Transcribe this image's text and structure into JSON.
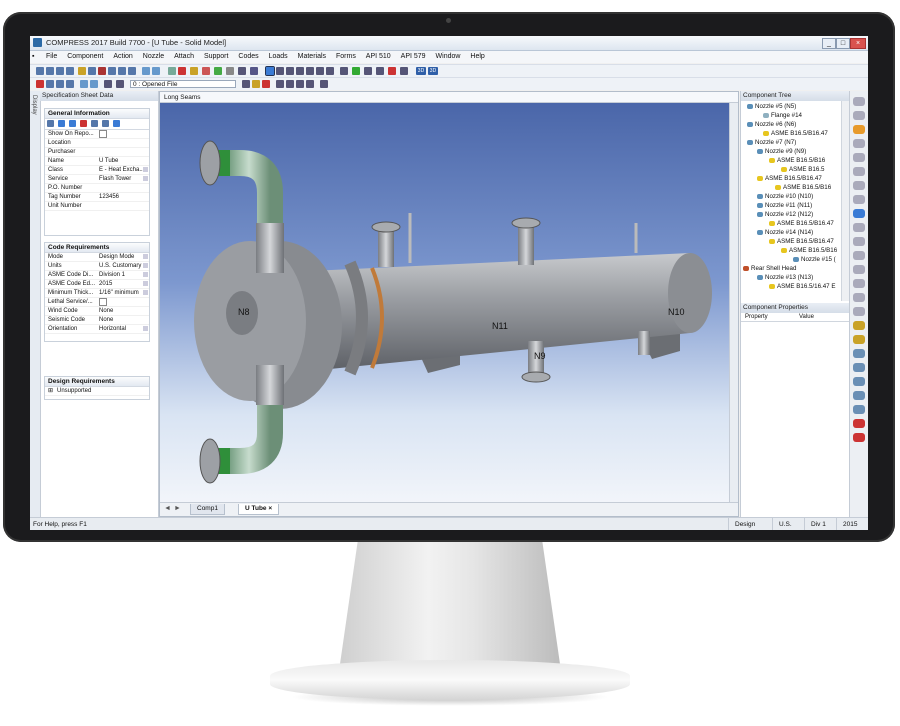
{
  "window": {
    "title": "COMPRESS 2017 Build 7700 - [U Tube - Solid Model]",
    "controls": [
      "_",
      "□",
      "×"
    ]
  },
  "menu": [
    "File",
    "Component",
    "Action",
    "Nozzle",
    "Attach",
    "Support",
    "Codes",
    "Loads",
    "Materials",
    "Forms",
    "API 510",
    "API 579",
    "Window",
    "Help"
  ],
  "toolbar": {
    "file_combo": "0 : Opened File",
    "view3d_label": "3D"
  },
  "left_panel": {
    "vertical_tab": "Display",
    "header": "Specification Sheet Data",
    "general": {
      "title": "General Information",
      "rows": [
        {
          "k": "Show On Repo...",
          "v": ""
        },
        {
          "k": "Location",
          "v": ""
        },
        {
          "k": "Purchaser",
          "v": ""
        },
        {
          "k": "Name",
          "v": "U Tube"
        },
        {
          "k": "Class",
          "v": "E - Heat Excha..."
        },
        {
          "k": "Service",
          "v": "Flash Tower"
        },
        {
          "k": "P.O. Number",
          "v": ""
        },
        {
          "k": "Tag Number",
          "v": "123456"
        },
        {
          "k": "Unit Number",
          "v": ""
        }
      ]
    },
    "code": {
      "title": "Code Requirements",
      "rows": [
        {
          "k": "Mode",
          "v": "Design Mode"
        },
        {
          "k": "Units",
          "v": "U.S. Customary"
        },
        {
          "k": "ASME Code Di...",
          "v": "Division 1"
        },
        {
          "k": "ASME Code Ed...",
          "v": "2015"
        },
        {
          "k": "Minimum Thick...",
          "v": "1/16\" minimum"
        },
        {
          "k": "Lethal Service/...",
          "v": ""
        },
        {
          "k": "Wind Code",
          "v": "None"
        },
        {
          "k": "Seismic Code",
          "v": "None"
        },
        {
          "k": "Orientation",
          "v": "Horizontal"
        }
      ]
    },
    "design": {
      "title": "Design Requirements",
      "item": "Unsupported"
    }
  },
  "document": {
    "title": "Long Seams",
    "labels": {
      "n8": "N8",
      "n11": "N11",
      "n9": "N9",
      "n10": "N10"
    },
    "tabs": [
      "Comp1",
      "U Tube"
    ]
  },
  "component_tree": {
    "header": "Component Tree",
    "items": [
      "Nozzle #5 (N5)",
      "Flange #14",
      "Nozzle #6 (N6)",
      "ASME B16.5/B16.47",
      "Nozzle #7 (N7)",
      "Nozzle #9 (N9)",
      "ASME B16.5/B16",
      "ASME B16.5",
      "ASME B16.5/B16.47",
      "ASME B16.5/B16",
      "Nozzle #10 (N10)",
      "Nozzle #11 (N11)",
      "Nozzle #12 (N12)",
      "ASME B16.5/B16.47",
      "Nozzle #14 (N14)",
      "ASME B16.5/B16.47",
      "ASME B16.5/B16",
      "Nozzle #15 (",
      "Rear Shell Head",
      "Nozzle #13 (N13)",
      "ASME B16.5/16.47 E"
    ]
  },
  "properties": {
    "header": "Component Properties",
    "columns": [
      "Property",
      "Value"
    ]
  },
  "status": {
    "help": "For Help, press F1",
    "fields": [
      "Design",
      "U.S.",
      "Div 1",
      "2015"
    ]
  },
  "colors": {
    "vessel": "#8f9298",
    "flange_green": "#2f8f3a",
    "pipe_green": "#8fb99a",
    "seam_orange": "#c07a3a"
  }
}
